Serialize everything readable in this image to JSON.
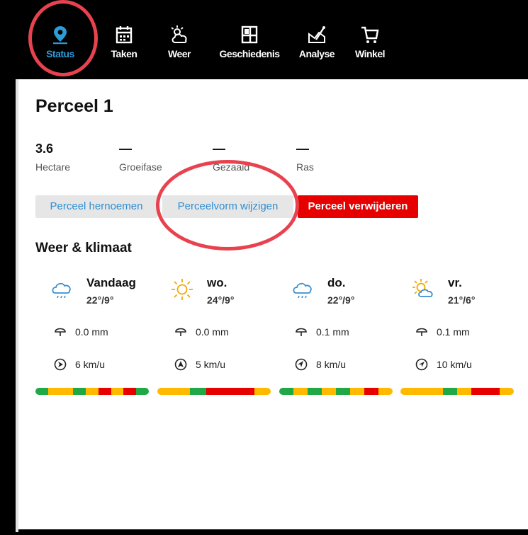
{
  "nav": [
    {
      "label": "Status",
      "icon": "map-pin-icon",
      "active": true
    },
    {
      "label": "Taken",
      "icon": "calendar-icon",
      "active": false
    },
    {
      "label": "Weer",
      "icon": "cloud-sun-icon",
      "active": false
    },
    {
      "label": "Geschiedenis",
      "icon": "history-grid-icon",
      "active": false
    },
    {
      "label": "Analyse",
      "icon": "analysis-chart-icon",
      "active": false
    },
    {
      "label": "Winkel",
      "icon": "cart-icon",
      "active": false
    }
  ],
  "colors": {
    "accent": "#2e9bd6",
    "danger": "#e60000",
    "annotation": "#e8424f",
    "green": "#1fa845",
    "yellow": "#ffba00",
    "red": "#e60000",
    "orange": "#f28c00"
  },
  "parcel": {
    "title": "Perceel 1",
    "stats": [
      {
        "value": "3.6",
        "caption": "Hectare"
      },
      {
        "value": "—",
        "caption": "Groeifase"
      },
      {
        "value": "—",
        "caption": "Gezaaid"
      },
      {
        "value": "—",
        "caption": "Ras"
      }
    ],
    "buttons": {
      "rename": "Perceel hernoemen",
      "reshape": "Perceelvorm wijzigen",
      "delete": "Perceel verwijderen"
    }
  },
  "weather": {
    "section_title": "Weer & klimaat",
    "days": [
      {
        "name": "Vandaag",
        "temp": "22°/9°",
        "icon": "rain-cloud-icon",
        "rain": "0.0 mm",
        "wind": "6 km/u",
        "bar": [
          "green",
          "yellow",
          "yellow",
          "green",
          "yellow",
          "red",
          "yellow",
          "red",
          "green"
        ]
      },
      {
        "name": "wo.",
        "temp": "24°/9°",
        "icon": "sun-icon",
        "rain": "0.0 mm",
        "wind": "5 km/u",
        "bar": [
          "yellow",
          "yellow",
          "green",
          "red",
          "red",
          "red",
          "yellow"
        ]
      },
      {
        "name": "do.",
        "temp": "22°/9°",
        "icon": "rain-cloud-icon",
        "rain": "0.1 mm",
        "wind": "8 km/u",
        "bar": [
          "green",
          "yellow",
          "green",
          "yellow",
          "green",
          "yellow",
          "red",
          "yellow"
        ]
      },
      {
        "name": "vr.",
        "temp": "21°/6°",
        "icon": "sun-cloud-icon",
        "rain": "0.1 mm",
        "wind": "10 km/u",
        "bar": [
          "yellow",
          "yellow",
          "yellow",
          "green",
          "yellow",
          "red",
          "red",
          "yellow"
        ]
      }
    ]
  }
}
